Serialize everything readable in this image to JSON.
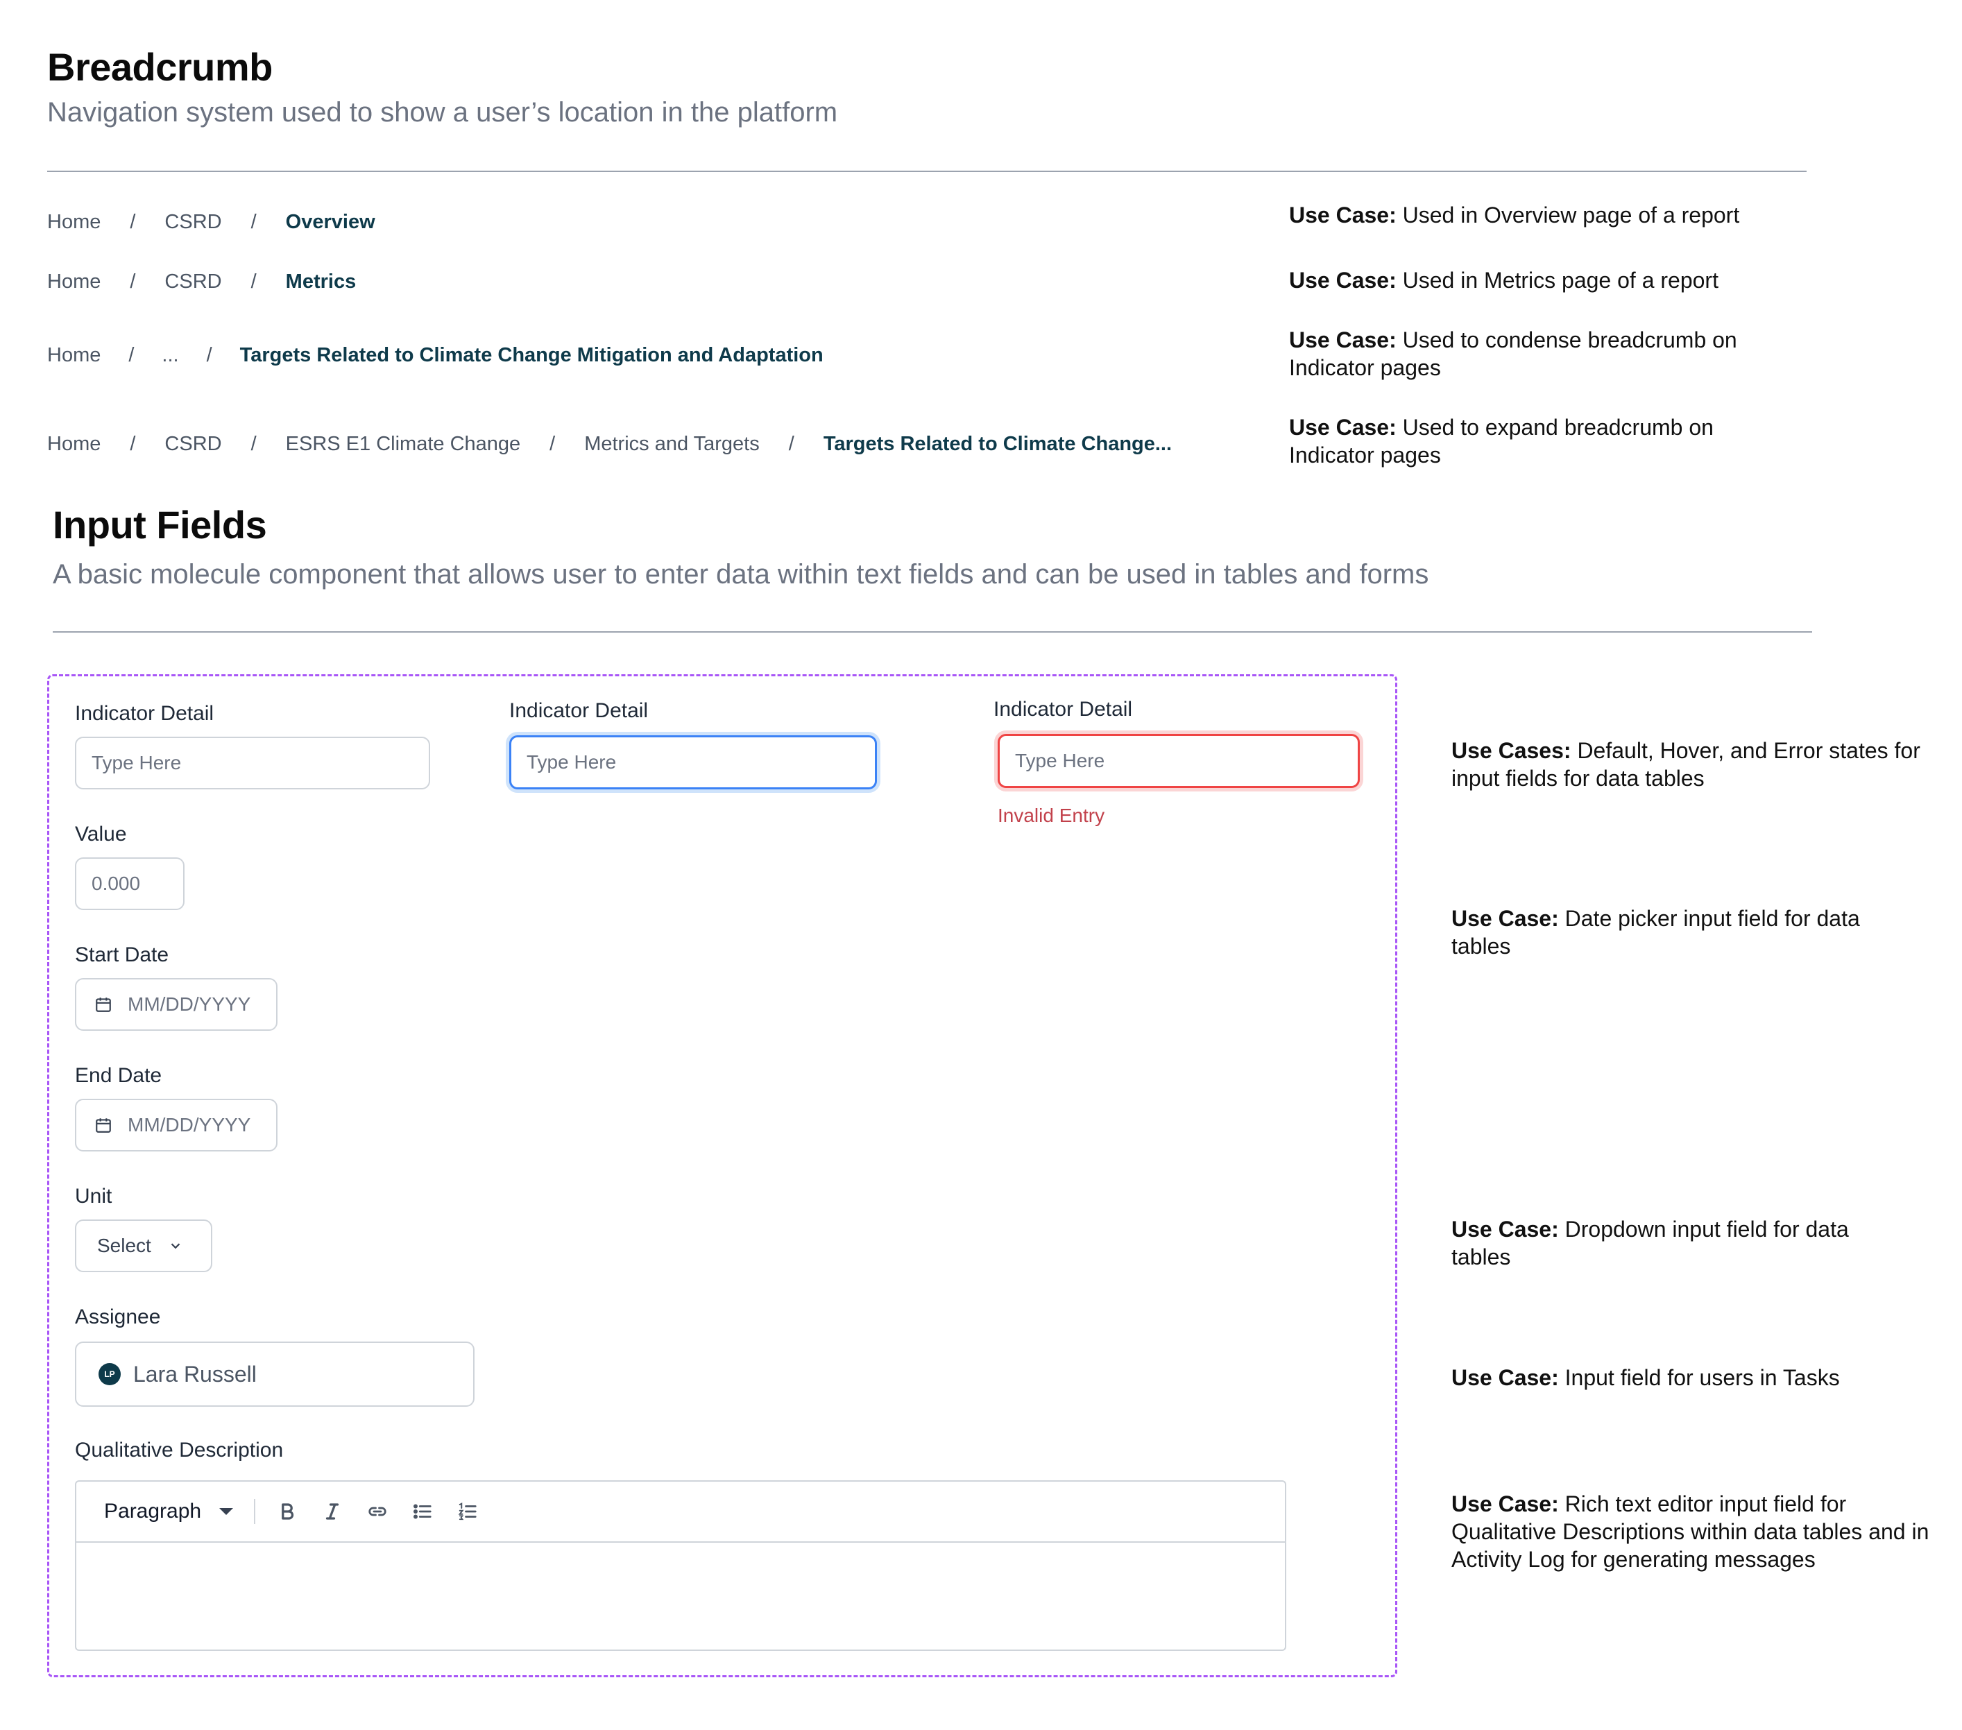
{
  "breadcrumb_section": {
    "title": "Breadcrumb",
    "subtitle": "Navigation system used to show a user’s location in the platform",
    "examples": [
      {
        "items": [
          "Home",
          "CSRD"
        ],
        "current": "Overview",
        "use_case_label": "Use Case:",
        "use_case_text": "Used in Overview page of a report"
      },
      {
        "items": [
          "Home",
          "CSRD"
        ],
        "current": "Metrics",
        "use_case_label": "Use Case:",
        "use_case_text": "Used in Metrics page of a report"
      },
      {
        "items": [
          "Home",
          "..."
        ],
        "current": "Targets Related to Climate Change Mitigation and Adaptation",
        "use_case_label": "Use Case:",
        "use_case_text": "Used to condense breadcrumb on Indicator pages"
      },
      {
        "items": [
          "Home",
          "CSRD",
          "ESRS E1 Climate Change",
          "Metrics and Targets"
        ],
        "current": "Targets Related to Climate Change...",
        "use_case_label": "Use Case:",
        "use_case_text": "Used to expand breadcrumb on Indicator pages"
      }
    ],
    "separator": "/"
  },
  "input_section": {
    "title": "Input Fields",
    "subtitle": "A basic molecule component that allows user to enter data within text fields and can be used in tables and forms",
    "indicator_default": {
      "label": "Indicator Detail",
      "placeholder": "Type Here"
    },
    "indicator_hover": {
      "label": "Indicator Detail",
      "placeholder": "Type Here"
    },
    "indicator_error": {
      "label": "Indicator Detail",
      "placeholder": "Type Here",
      "error": "Invalid Entry"
    },
    "value": {
      "label": "Value",
      "placeholder": "0.000"
    },
    "start_date": {
      "label": "Start Date",
      "placeholder": "MM/DD/YYYY",
      "icon": "calendar-icon"
    },
    "end_date": {
      "label": "End Date",
      "placeholder": "MM/DD/YYYY",
      "icon": "calendar-icon"
    },
    "unit": {
      "label": "Unit",
      "value": "Select",
      "icon": "chevron-down-icon"
    },
    "assignee": {
      "label": "Assignee",
      "initials": "LP",
      "name": "Lara Russell"
    },
    "qualitative": {
      "label": "Qualitative Description",
      "format": "Paragraph",
      "tools": [
        "bold-icon",
        "italic-icon",
        "link-icon",
        "bullet-list-icon",
        "numbered-list-icon"
      ]
    },
    "use_cases": [
      {
        "label": "Use Cases:",
        "text": "Default, Hover, and Error states for input fields for data tables"
      },
      {
        "label": "Use Case:",
        "text": "Date picker input field for data tables"
      },
      {
        "label": "Use Case:",
        "text": "Dropdown input field for data tables"
      },
      {
        "label": "Use Case:",
        "text": "Input field for users in Tasks"
      },
      {
        "label": "Use Case:",
        "text": "Rich text editor input field for Qualitative Descriptions within data tables and in Activity Log for generating messages"
      }
    ]
  },
  "colors": {
    "current_crumb": "#0e3a4a",
    "frame_dashed": "#a855f7",
    "focus_border": "#3b82f6",
    "error": "#c2414b"
  }
}
